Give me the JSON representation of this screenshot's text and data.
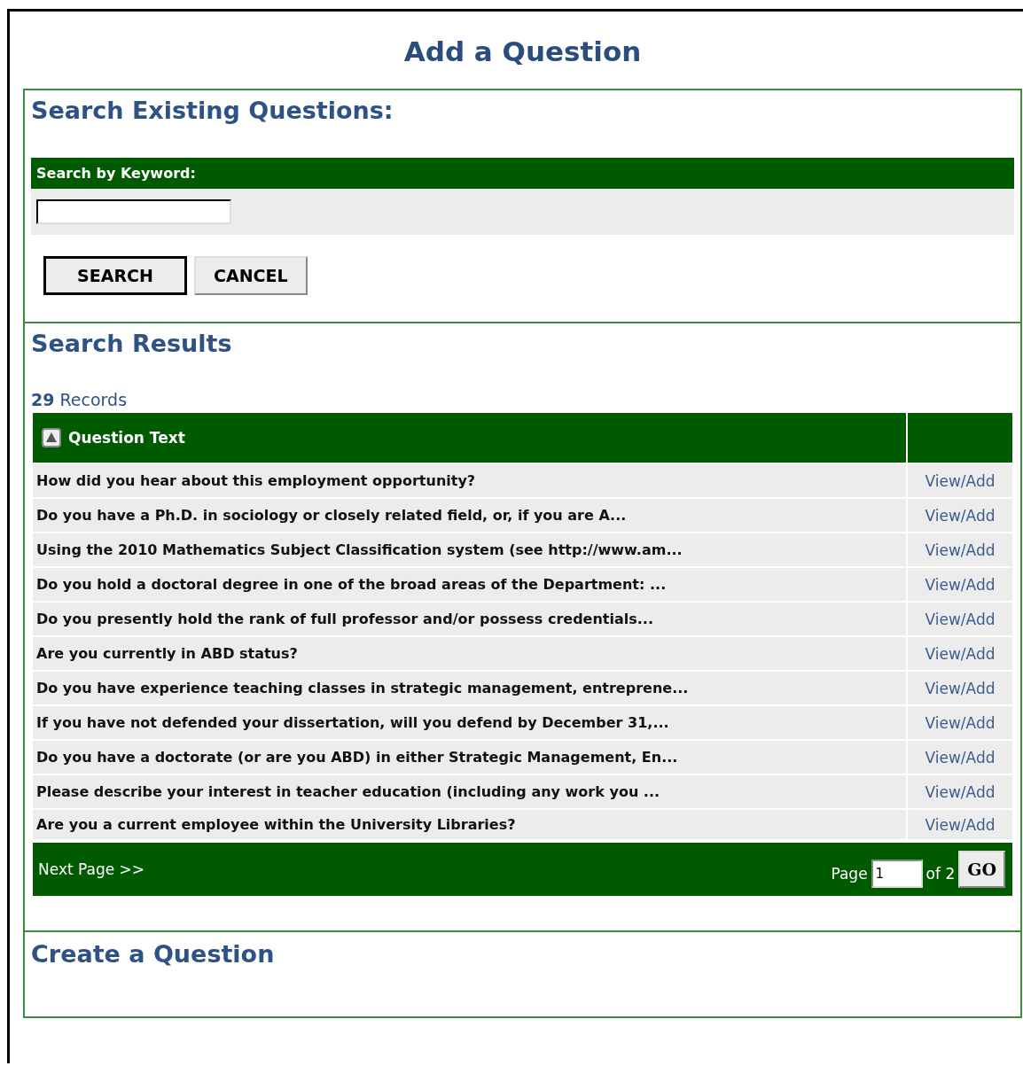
{
  "title": "Add a Question",
  "search": {
    "heading": "Search Existing Questions:",
    "field_label": "Search by Keyword:",
    "buttons": [
      {
        "label": "SEARCH",
        "default": true
      },
      {
        "label": "CANCEL",
        "default": false
      }
    ]
  },
  "results": {
    "heading": "Search Results",
    "count": "**29** Records",
    "columns": [
      "Question Text"
    ],
    "rows": [
      {
        "question": "How did you hear about this employment opportunity?",
        "action": "View/Add"
      },
      {
        "question": "Do you have a Ph.D. in sociology or closely related field, or, if you are A...",
        "action": "View/Add"
      },
      {
        "question": "Using the 2010 Mathematics Subject Classification system (see http://www.am...",
        "action": "View/Add"
      },
      {
        "question": "Do you hold a doctoral degree in one of the broad areas of the Department: ...",
        "action": "View/Add"
      },
      {
        "question": "Do you presently hold the rank of full professor and/or possess credentials...",
        "action": "View/Add"
      },
      {
        "question": "Are you currently in ABD status?",
        "action": "View/Add"
      },
      {
        "question": "Do you have experience teaching classes in strategic management, entreprene...",
        "action": "View/Add"
      },
      {
        "question": "If you have not defended your dissertation, will you defend by December 31,...",
        "action": "View/Add"
      },
      {
        "question": "Do you have a doctorate (or are you ABD) in either Strategic Management, En...",
        "action": "View/Add"
      },
      {
        "question": "Please describe your interest in teacher education (including any work you ...",
        "action": "View/Add"
      },
      {
        "question": "Are you a current employee within the University Libraries?",
        "action": "View/Add"
      }
    ],
    "pagination": {
      "next": "Next Page >>",
      "page_label": "Page",
      "page_value": "1",
      "of_label": "of 2",
      "go": "GO"
    }
  },
  "create": {
    "heading": "Create a Question"
  }
}
